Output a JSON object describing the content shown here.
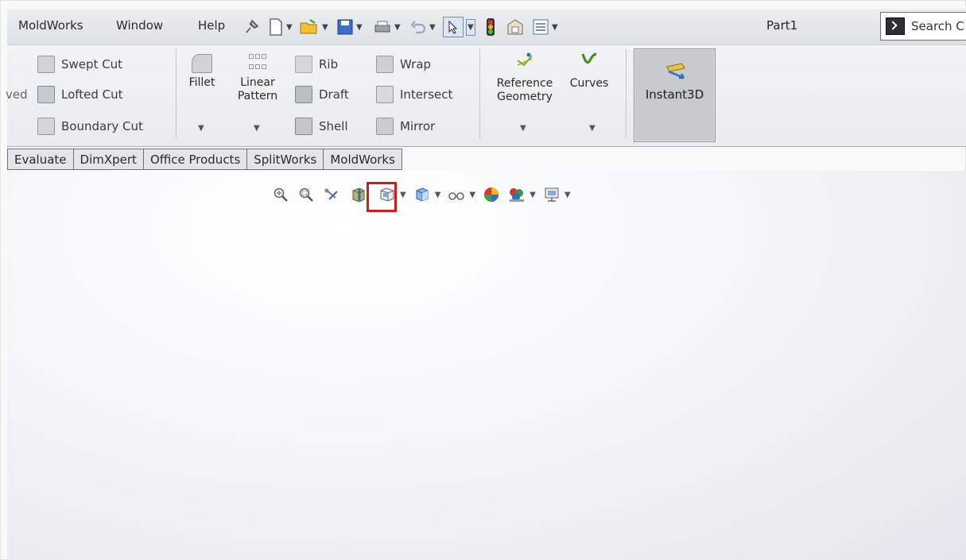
{
  "menu": {
    "items": [
      "MoldWorks",
      "Window",
      "Help"
    ],
    "doc_title": "Part1"
  },
  "search": {
    "placeholder": "Search C"
  },
  "ribbon": {
    "partial_label": "ved",
    "cut_tools": [
      "Swept Cut",
      "Lofted Cut",
      "Boundary Cut"
    ],
    "fillet": "Fillet",
    "linear_pattern": [
      "Linear",
      "Pattern"
    ],
    "features_col1": [
      "Rib",
      "Draft",
      "Shell"
    ],
    "features_col2": [
      "Wrap",
      "Intersect",
      "Mirror"
    ],
    "reference_geometry": [
      "Reference",
      "Geometry"
    ],
    "curves": "Curves",
    "instant3d": "Instant3D"
  },
  "tabs": [
    "Evaluate",
    "DimXpert",
    "Office Products",
    "SplitWorks",
    "MoldWorks"
  ],
  "icons": {
    "view_toolbar": [
      "zoom-to-fit-icon",
      "zoom-to-area-icon",
      "previous-view-icon",
      "section-view-icon",
      "view-orientation-icon",
      "display-style-icon",
      "hide-show-items-icon",
      "edit-appearance-icon",
      "apply-scene-icon",
      "view-settings-icon"
    ]
  },
  "colors": {
    "highlight": "#d11a22",
    "accent_blue": "#2f6fc2",
    "curves_green": "#3d8a1f"
  }
}
